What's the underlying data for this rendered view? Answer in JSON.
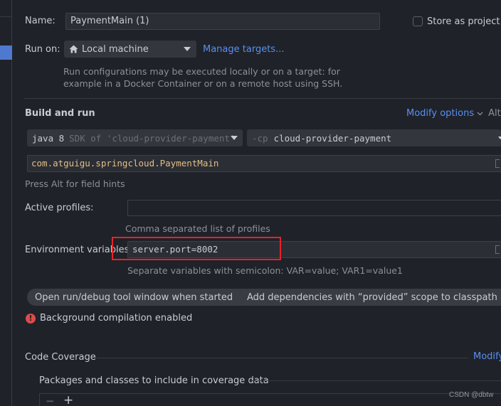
{
  "form": {
    "name_label": "Name:",
    "name_value": "PaymentMain (1)",
    "store_label": "Store as project fi",
    "run_on_label": "Run on:",
    "run_on_value": "Local machine",
    "manage_targets": "Manage targets...",
    "run_on_hint_1": "Run configurations may be executed locally or on a target: for",
    "run_on_hint_2": "example in a Docker Container or on a remote host using SSH."
  },
  "build_and_run": {
    "title": "Build and run",
    "modify_options": "Modify options",
    "modify_shortcut": "Alt+",
    "jdk_version": "java 8",
    "jdk_hint": "SDK of 'cloud-provider-payment'",
    "cp_prefix": "-cp",
    "cp_value": "cloud-provider-payment",
    "main_class": "com.atguigu.springcloud.PaymentMain",
    "field_hints": "Press Alt for field hints"
  },
  "profiles": {
    "label": "Active profiles:",
    "value": "",
    "hint": "Comma separated list of profiles"
  },
  "env": {
    "label": "Environment variables:",
    "value": "server.port=8002",
    "hint": "Separate variables with semicolon: VAR=value; VAR1=value1"
  },
  "chips": [
    {
      "label": "Open run/debug tool window when started",
      "close": "×"
    },
    {
      "label": "Add dependencies with “provided” scope to classpath",
      "close": "×"
    }
  ],
  "warning": {
    "icon": "!",
    "text": "Background compilation enabled"
  },
  "coverage": {
    "title": "Code Coverage",
    "modify": "Modify",
    "packages_label": "Packages and classes to include in coverage data",
    "remove": "−",
    "add": "+"
  },
  "watermark": "CSDN @dbtw",
  "colors": {
    "accent": "#5a8ff0",
    "highlight_box": "#e8222a",
    "error": "#db4b4b",
    "background": "#1f2229"
  }
}
